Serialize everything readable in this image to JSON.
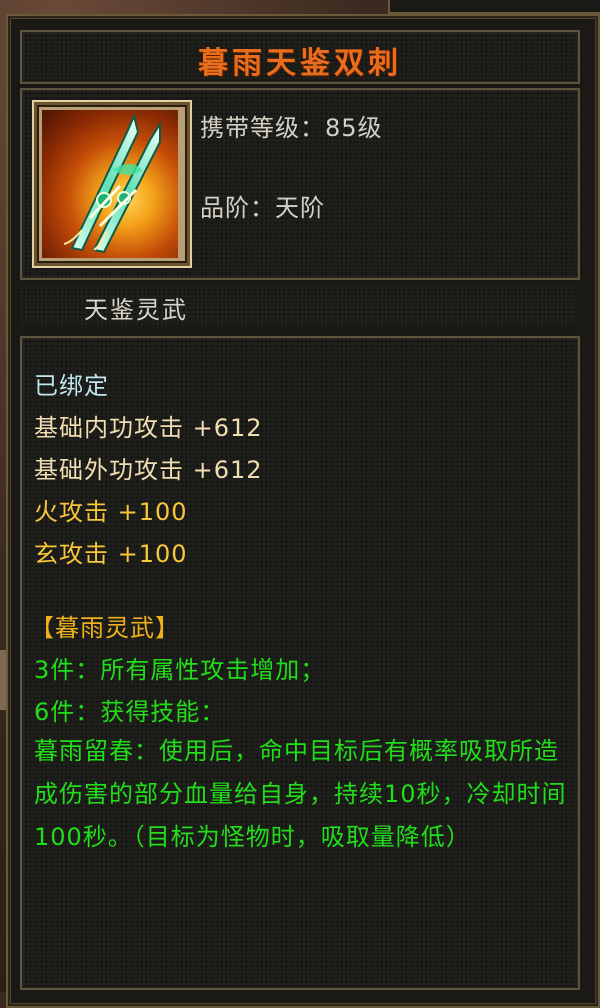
{
  "item": {
    "name": "暮雨天鉴双刺",
    "carry_level": "携带等级：85级",
    "grade": "品阶：天阶",
    "category": "天鉴灵武",
    "icon": "twin-blade-weapon-icon"
  },
  "attributes": {
    "bound": "已绑定",
    "base_lines": [
      "基础内功攻击 +612",
      "基础外功攻击 +612"
    ],
    "element_lines": [
      "火攻击 +100",
      "玄攻击 +100"
    ]
  },
  "set_bonus": {
    "title": "【暮雨灵武】",
    "lines": [
      "3件：所有属性攻击增加；",
      "6件：获得技能："
    ],
    "skill_description": "暮雨留春：使用后，命中目标后有概率吸取所造成伤害的部分血量给自身，持续10秒，冷却时间100秒。（目标为怪物时，吸取量降低）"
  },
  "colors": {
    "title": "#e86e1e",
    "bound": "#bfe4ee",
    "base": "#f0deb2",
    "element": "#f8c63a",
    "set_text": "#22dd1a"
  }
}
